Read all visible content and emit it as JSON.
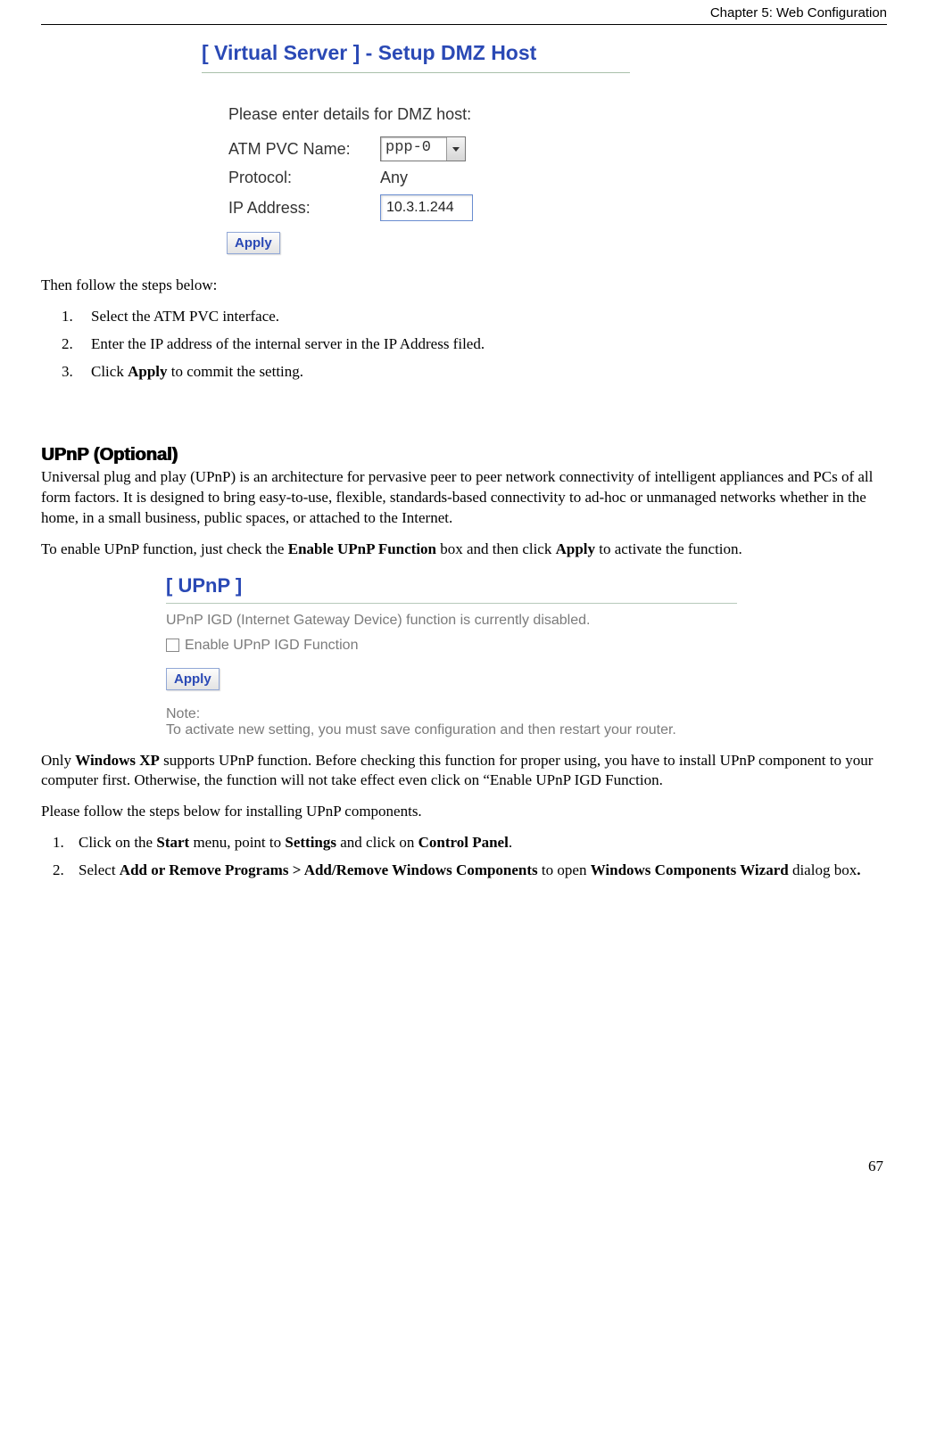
{
  "chapter_header": "Chapter 5: Web Configuration",
  "vs": {
    "title": "[ Virtual Server ] - Setup DMZ Host",
    "prompt": "Please enter details for DMZ host:",
    "atm_label": "ATM PVC Name:",
    "atm_value": "ppp-0",
    "protocol_label": "Protocol:",
    "protocol_value": "Any",
    "ip_label": "IP Address:",
    "ip_value": "10.3.1.244",
    "apply": "Apply"
  },
  "intro_then": "Then follow the steps below:",
  "steps_a": {
    "s1": "Select the ATM PVC interface.",
    "s2": "Enter the IP address of the internal server in the IP Address filed.",
    "s3_a": "Click ",
    "s3_b": "Apply",
    "s3_c": " to commit the setting."
  },
  "upnp_heading": "UPnP (Optional)",
  "upnp_desc": "Universal plug and play (UPnP) is an architecture for pervasive peer to peer network connectivity of intelligent appliances and PCs of all form factors. It is designed to bring easy-to-use, flexible, standards-based connectivity to ad-hoc or unmanaged networks whether in the home, in a small business, public spaces, or attached to the Internet.",
  "upnp_enable_text": {
    "a": "To enable UPnP function, just check the ",
    "b": "Enable UPnP Function",
    "c": " box and then click ",
    "d": "Apply",
    "e": " to activate the function."
  },
  "upnp_panel": {
    "title": "[ UPnP ]",
    "status": "UPnP IGD (Internet Gateway Device) function is currently disabled.",
    "checkbox_label": "Enable UPnP IGD Function",
    "apply": "Apply",
    "note_h": "Note:",
    "note": "To activate new setting, you must save configuration and then restart your router."
  },
  "xp_text": {
    "a": "Only ",
    "b": "Windows XP",
    "c": " supports UPnP function. Before checking this function for proper using, you have to install UPnP component to your computer first. Otherwise, the function will not take effect even click on “Enable UPnP IGD Function."
  },
  "follow_steps": "Please follow the steps below for installing UPnP components.",
  "steps_b": {
    "s1_a": "Click on the ",
    "s1_b": "Start",
    "s1_c": " menu, point to ",
    "s1_d": "Settings",
    "s1_e": " and click on ",
    "s1_f": "Control Panel",
    "s1_g": ".",
    "s2_a": "Select ",
    "s2_b": "Add or Remove Programs > Add/Remove Windows Components",
    "s2_c": " to open ",
    "s2_d": "Windows Components Wizard",
    "s2_e": " dialog box",
    "s2_f": "."
  },
  "page_number": "67"
}
